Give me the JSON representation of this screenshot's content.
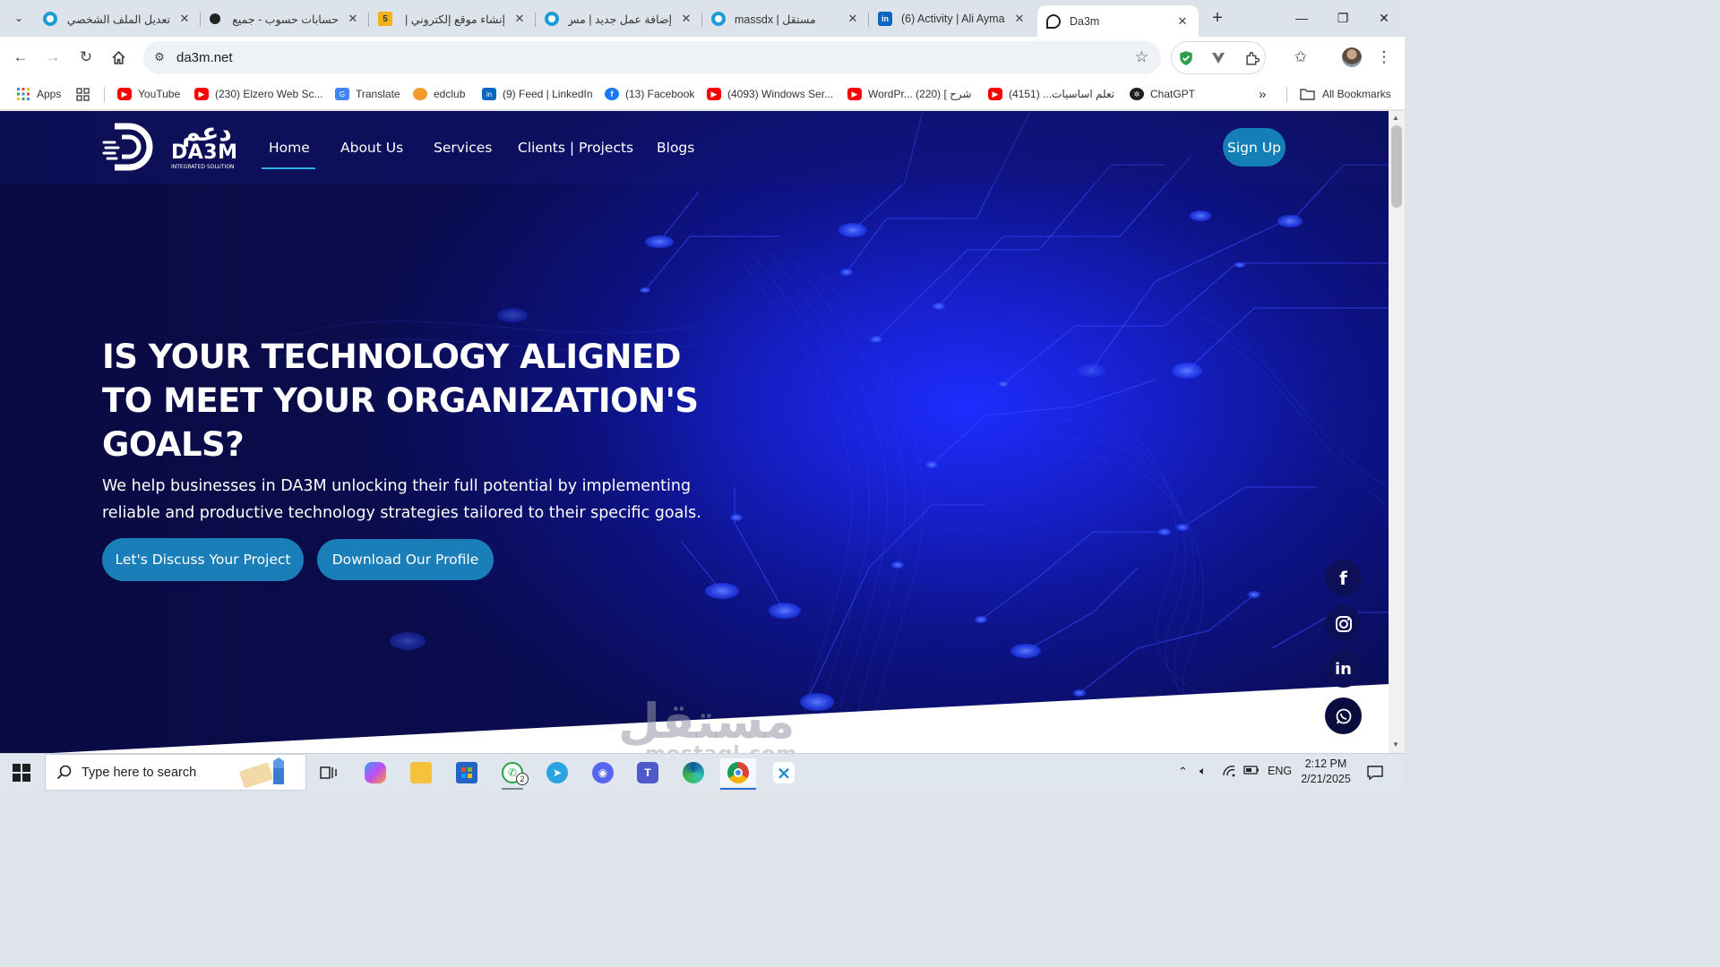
{
  "browser": {
    "tabs": [
      {
        "title": "تعديل الملف الشخصي",
        "icon": "mostaql-icon"
      },
      {
        "title": "حسابات حسوب - جميع",
        "icon": "hsoub-icon"
      },
      {
        "title": "إنشاء موقع إلكتروني |",
        "icon": "five-icon"
      },
      {
        "title": "إضافة عمل جديد | مس",
        "icon": "mostaql-icon"
      },
      {
        "title": "massdx | مستقل",
        "icon": "mostaql-icon"
      },
      {
        "title": "(6) Activity | Ali Ayma",
        "icon": "linkedin-icon"
      },
      {
        "title": "Da3m",
        "icon": "da3m-icon",
        "active": true
      }
    ],
    "new_tab": "+",
    "window_controls": {
      "minimize": "—",
      "maximize": "❐",
      "close": "✕"
    },
    "address": "da3m.net",
    "bookmarks": [
      {
        "label": "Apps",
        "icon": "apps-grid-icon"
      },
      {
        "label": "",
        "icon": "tab-groups-icon"
      },
      {
        "label": "YouTube",
        "icon": "youtube-icon"
      },
      {
        "label": "(230) Elzero Web Sc...",
        "icon": "youtube-icon"
      },
      {
        "label": "Translate",
        "icon": "translate-icon"
      },
      {
        "label": "edclub",
        "icon": "edclub-icon"
      },
      {
        "label": "(9) Feed | LinkedIn",
        "icon": "linkedin-icon"
      },
      {
        "label": "(13) Facebook",
        "icon": "facebook-icon"
      },
      {
        "label": "(4093) Windows Ser...",
        "icon": "youtube-icon"
      },
      {
        "label": "WordPr... شرح ] (220)",
        "icon": "youtube-icon"
      },
      {
        "label": "تعلم اساسيات... (4151)",
        "icon": "youtube-icon"
      },
      {
        "label": "ChatGPT",
        "icon": "chatgpt-icon"
      }
    ],
    "bookmarks_overflow": "»",
    "all_bookmarks": "All Bookmarks"
  },
  "site": {
    "logo_arabic": "دعم",
    "logo_text": "DA3M",
    "logo_tagline": "INTEGRATED SOLUTION",
    "nav": [
      {
        "label": "Home",
        "active": true
      },
      {
        "label": "About Us"
      },
      {
        "label": "Services"
      },
      {
        "label": "Clients | Projects"
      },
      {
        "label": "Blogs"
      }
    ],
    "signup": "Sign Up",
    "hero_title": "IS YOUR TECHNOLOGY ALIGNED TO MEET YOUR ORGANIZATION'S GOALS?",
    "hero_subtitle": "We help businesses in DA3M unlocking their full potential by implementing reliable and productive technology strategies tailored to their specific goals.",
    "cta_primary": "Let's Discuss Your Project",
    "cta_secondary": "Download Our Profile",
    "social": [
      {
        "icon": "facebook-icon",
        "glyph": "f"
      },
      {
        "icon": "instagram-icon",
        "glyph": "◎"
      },
      {
        "icon": "linkedin-icon",
        "glyph": "in"
      },
      {
        "icon": "whatsapp-icon",
        "glyph": "✆"
      }
    ],
    "watermark": "مستقل",
    "watermark_sub": "mostaql.com",
    "colors": {
      "accent": "#137fb6",
      "background": "#0b0f63",
      "primary_glow": "#1f2cff"
    }
  },
  "taskbar": {
    "search_placeholder": "Type here to search",
    "whatsapp_badge": "2",
    "tray_lang": "ENG",
    "time": "2:12 PM",
    "date": "2/21/2025"
  }
}
